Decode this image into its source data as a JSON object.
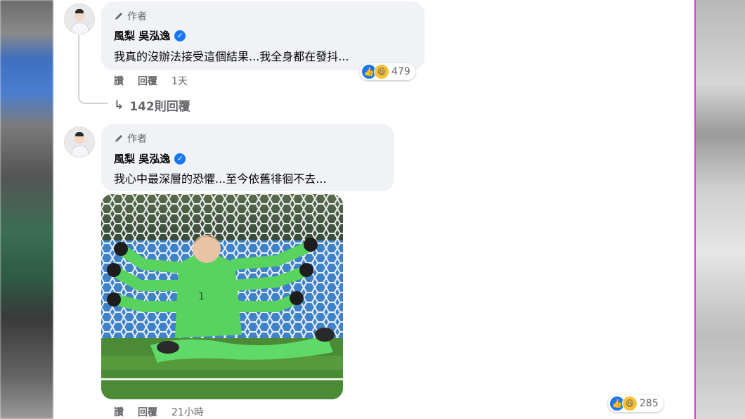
{
  "comments": [
    {
      "author_tag": "作者",
      "name": "風梨 吳泓逸",
      "text": "我真的沒辦法接受這個結果...我全身都在發抖...",
      "actions": {
        "like": "讚",
        "reply": "回覆",
        "time": "1天"
      },
      "reactions": {
        "count": "479",
        "types": [
          "like-icon",
          "haha-icon"
        ]
      },
      "replies_label": "142則回覆"
    },
    {
      "author_tag": "作者",
      "name": "風梨 吳泓逸",
      "text": "我心中最深層的恐懼...至今依舊徘徊不去...",
      "actions": {
        "like": "讚",
        "reply": "回覆",
        "time": "21小時"
      },
      "reactions": {
        "count": "285",
        "types": [
          "like-icon",
          "haha-icon"
        ]
      }
    }
  ],
  "colors": {
    "bubble": "#f0f2f5",
    "secondary_text": "#65676b",
    "verified": "#1877f2",
    "like": "#1877f2",
    "haha": "#f7c233",
    "goalkeeper_kit": "#58d35e"
  }
}
